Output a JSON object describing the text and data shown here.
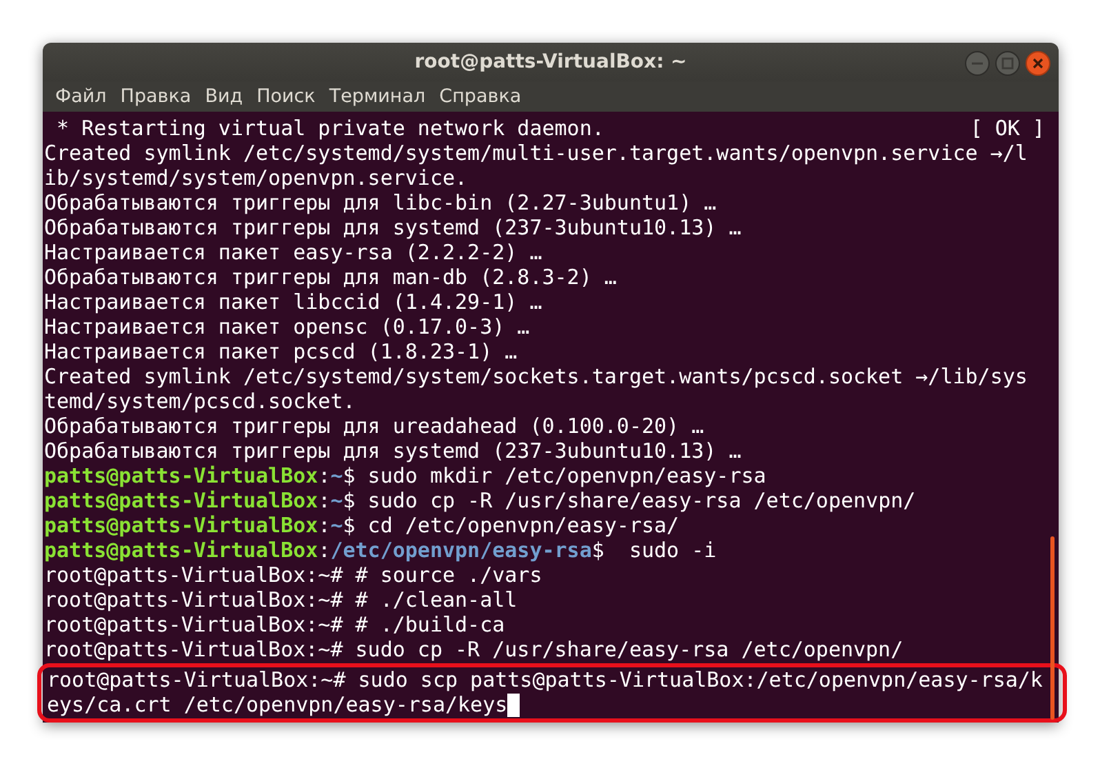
{
  "window": {
    "title": "root@patts-VirtualBox: ~"
  },
  "menu": [
    "Файл",
    "Правка",
    "Вид",
    "Поиск",
    "Терминал",
    "Справка"
  ],
  "lines": [
    {
      "segments": [
        {
          "kind": "plain",
          "text": " * Restarting virtual private network daemon."
        },
        {
          "kind": "status",
          "text": "[ OK ]"
        }
      ]
    },
    {
      "segments": [
        {
          "kind": "plain",
          "text": "Created symlink /etc/systemd/system/multi-user.target.wants/openvpn.service →/l"
        }
      ]
    },
    {
      "segments": [
        {
          "kind": "plain",
          "text": "ib/systemd/system/openvpn.service."
        }
      ]
    },
    {
      "segments": [
        {
          "kind": "plain",
          "text": "Обрабатываются триггеры для libc-bin (2.27-3ubuntu1) …"
        }
      ]
    },
    {
      "segments": [
        {
          "kind": "plain",
          "text": "Обрабатываются триггеры для systemd (237-3ubuntu10.13) …"
        }
      ]
    },
    {
      "segments": [
        {
          "kind": "plain",
          "text": "Настраивается пакет easy-rsa (2.2.2-2) …"
        }
      ]
    },
    {
      "segments": [
        {
          "kind": "plain",
          "text": "Обрабатываются триггеры для man-db (2.8.3-2) …"
        }
      ]
    },
    {
      "segments": [
        {
          "kind": "plain",
          "text": "Настраивается пакет libccid (1.4.29-1) …"
        }
      ]
    },
    {
      "segments": [
        {
          "kind": "plain",
          "text": "Настраивается пакет opensc (0.17.0-3) …"
        }
      ]
    },
    {
      "segments": [
        {
          "kind": "plain",
          "text": "Настраивается пакет pcscd (1.8.23-1) …"
        }
      ]
    },
    {
      "segments": [
        {
          "kind": "plain",
          "text": "Created symlink /etc/systemd/system/sockets.target.wants/pcscd.socket →/lib/sys"
        }
      ]
    },
    {
      "segments": [
        {
          "kind": "plain",
          "text": "temd/system/pcscd.socket."
        }
      ]
    },
    {
      "segments": [
        {
          "kind": "plain",
          "text": "Обрабатываются триггеры для ureadahead (0.100.0-20) …"
        }
      ]
    },
    {
      "segments": [
        {
          "kind": "plain",
          "text": "Обрабатываются триггеры для systemd (237-3ubuntu10.13) …"
        }
      ]
    },
    {
      "segments": [
        {
          "kind": "user",
          "text": "patts@patts-VirtualBox"
        },
        {
          "kind": "plain",
          "text": ":"
        },
        {
          "kind": "cwd",
          "text": "~"
        },
        {
          "kind": "plain",
          "text": "$ sudo mkdir /etc/openvpn/easy-rsa"
        }
      ]
    },
    {
      "segments": [
        {
          "kind": "user",
          "text": "patts@patts-VirtualBox"
        },
        {
          "kind": "plain",
          "text": ":"
        },
        {
          "kind": "cwd",
          "text": "~"
        },
        {
          "kind": "plain",
          "text": "$ sudo cp -R /usr/share/easy-rsa /etc/openvpn/"
        }
      ]
    },
    {
      "segments": [
        {
          "kind": "user",
          "text": "patts@patts-VirtualBox"
        },
        {
          "kind": "plain",
          "text": ":"
        },
        {
          "kind": "cwd",
          "text": "~"
        },
        {
          "kind": "plain",
          "text": "$ cd /etc/openvpn/easy-rsa/"
        }
      ]
    },
    {
      "segments": [
        {
          "kind": "user",
          "text": "patts@patts-VirtualBox"
        },
        {
          "kind": "plain",
          "text": ":"
        },
        {
          "kind": "cwd",
          "text": "/etc/openvpn/easy-rsa"
        },
        {
          "kind": "plain",
          "text": "$  sudo -i"
        }
      ]
    },
    {
      "segments": [
        {
          "kind": "plain",
          "text": "root@patts-VirtualBox:~# # source ./vars"
        }
      ]
    },
    {
      "segments": [
        {
          "kind": "plain",
          "text": "root@patts-VirtualBox:~# # ./clean-all"
        }
      ]
    },
    {
      "segments": [
        {
          "kind": "plain",
          "text": "root@patts-VirtualBox:~# # ./build-ca"
        }
      ]
    },
    {
      "segments": [
        {
          "kind": "plain",
          "text": "root@patts-VirtualBox:~# sudo cp -R /usr/share/easy-rsa /etc/openvpn/"
        }
      ]
    }
  ],
  "highlighted_lines": [
    {
      "segments": [
        {
          "kind": "plain",
          "text": "root@patts-VirtualBox:~# sudo scp patts@patts-VirtualBox:/etc/openvpn/easy-rsa/k"
        }
      ],
      "cursor": false
    },
    {
      "segments": [
        {
          "kind": "plain",
          "text": "eys/ca.crt /etc/openvpn/easy-rsa/keys"
        }
      ],
      "cursor": true
    }
  ]
}
